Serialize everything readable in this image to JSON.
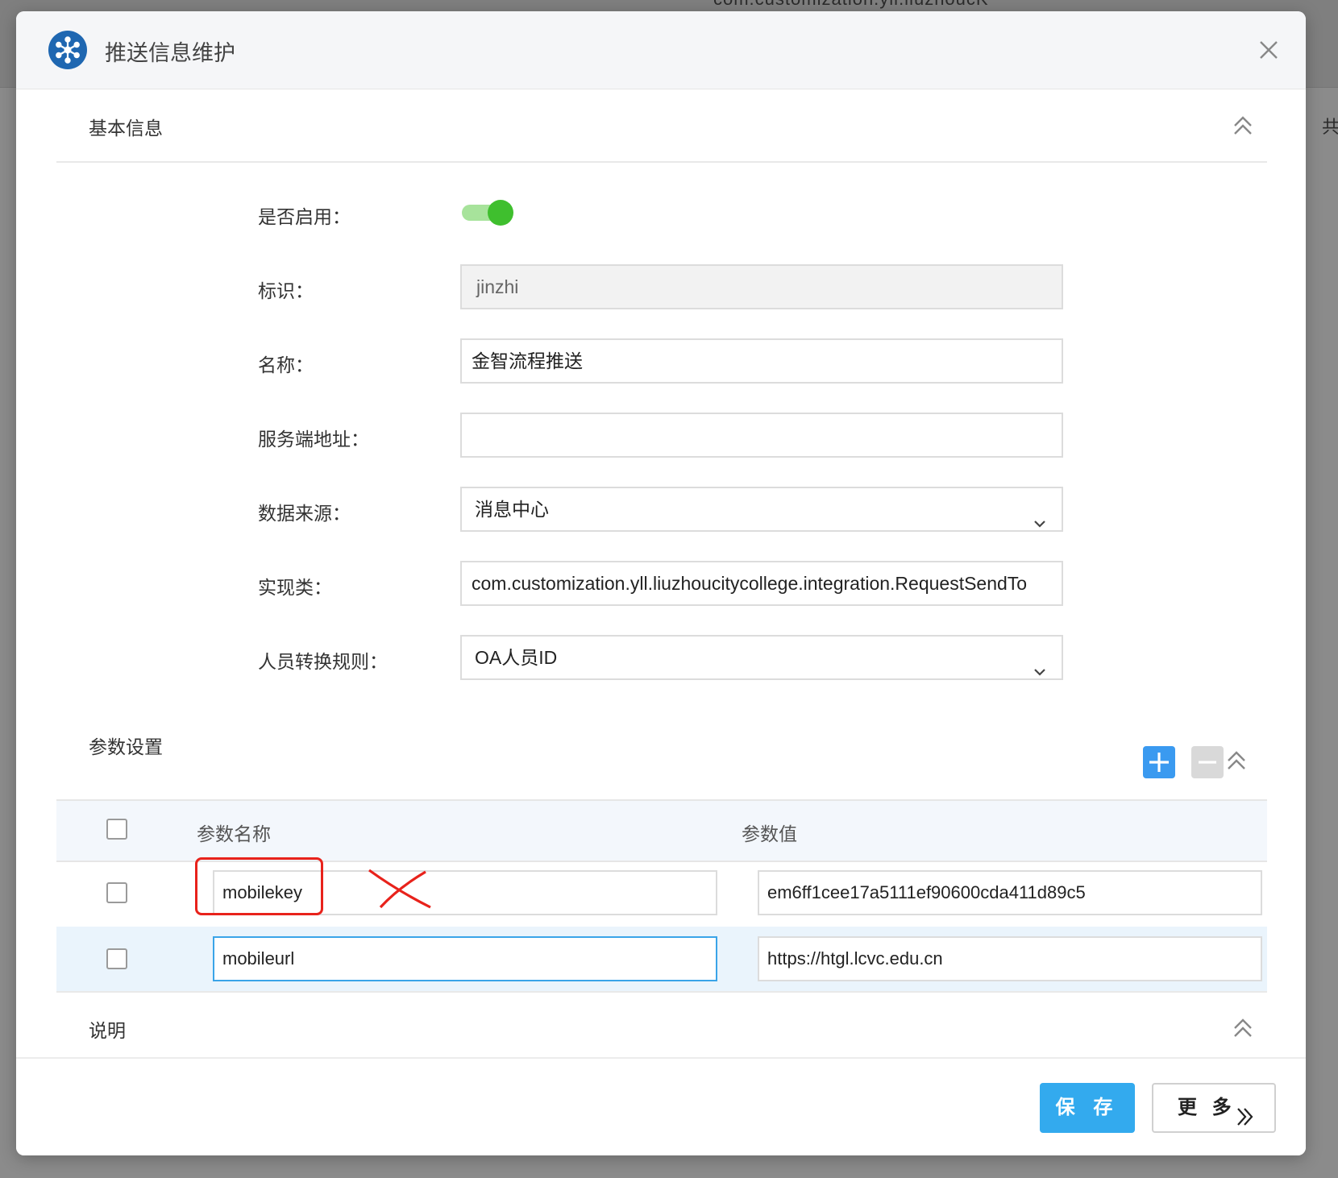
{
  "background": {
    "top_text": "com.customization.yll.liuzhoucK",
    "right_text": "共"
  },
  "dialog": {
    "title": "推送信息维护",
    "logo_icon": "snowflake-icon",
    "close_icon": "close-icon"
  },
  "basic_section": {
    "title": "基本信息",
    "fields": {
      "enabled": {
        "label": "是否启用：",
        "value": true
      },
      "id": {
        "label": "标识：",
        "value": "jinzhi"
      },
      "name": {
        "label": "名称：",
        "value": "金智流程推送"
      },
      "server_address": {
        "label": "服务端地址：",
        "value": ""
      },
      "data_source": {
        "label": "数据来源：",
        "value": "消息中心"
      },
      "impl_class": {
        "label": "实现类：",
        "value": "com.customization.yll.liuzhoucitycollege.integration.RequestSendTo"
      },
      "person_rule": {
        "label": "人员转换规则：",
        "value": "OA人员ID"
      }
    }
  },
  "params_section": {
    "title": "参数设置",
    "columns": [
      "参数名称",
      "参数值"
    ],
    "rows": [
      {
        "name": "mobilekey",
        "value": "em6ff1cee17a5111ef90600cda411d89c5"
      },
      {
        "name": "mobileurl",
        "value": "https://htgl.lcvc.edu.cn"
      }
    ]
  },
  "notes_section": {
    "title": "说明"
  },
  "footer": {
    "save_label": "保 存",
    "more_label": "更 多"
  },
  "colors": {
    "primary": "#33aaee",
    "add_button": "#3a9af0",
    "toggle_on": "#3fbf2e",
    "annotation": "#e8221b"
  }
}
